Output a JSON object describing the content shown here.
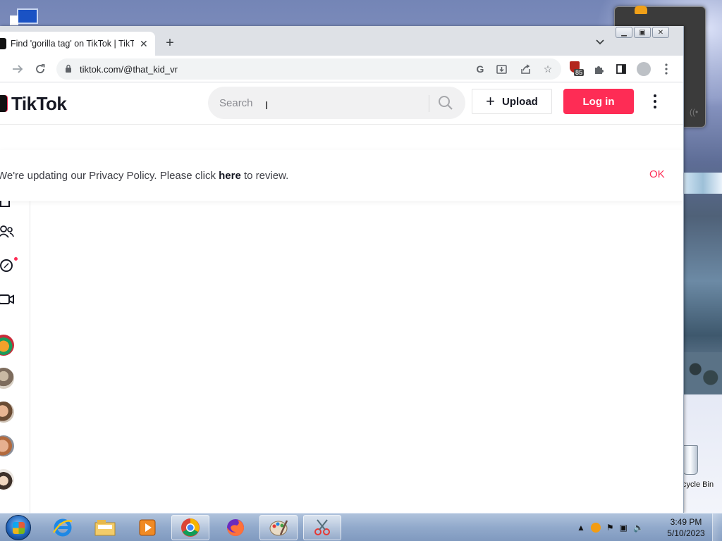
{
  "browser": {
    "tab": {
      "title": "Find 'gorilla tag' on TikTok | TikTok"
    },
    "address": {
      "url": "tiktok.com/@that_kid_vr"
    },
    "extension_badge": "85"
  },
  "tiktok": {
    "logo_text": "TikTok",
    "search": {
      "placeholder": "Search"
    },
    "upload_label": "Upload",
    "login_label": "Log in",
    "privacy_banner": {
      "before": "We're updating our Privacy Policy. Please click ",
      "link": "here",
      "after": " to review.",
      "ok": "OK"
    }
  },
  "desktop": {
    "recycle_bin_label": "Recycle Bin"
  },
  "taskbar": {
    "time": "3:49 PM",
    "date": "5/10/2023"
  },
  "colors": {
    "tiktok_red": "#fe2c55",
    "text_dark": "#161823"
  }
}
